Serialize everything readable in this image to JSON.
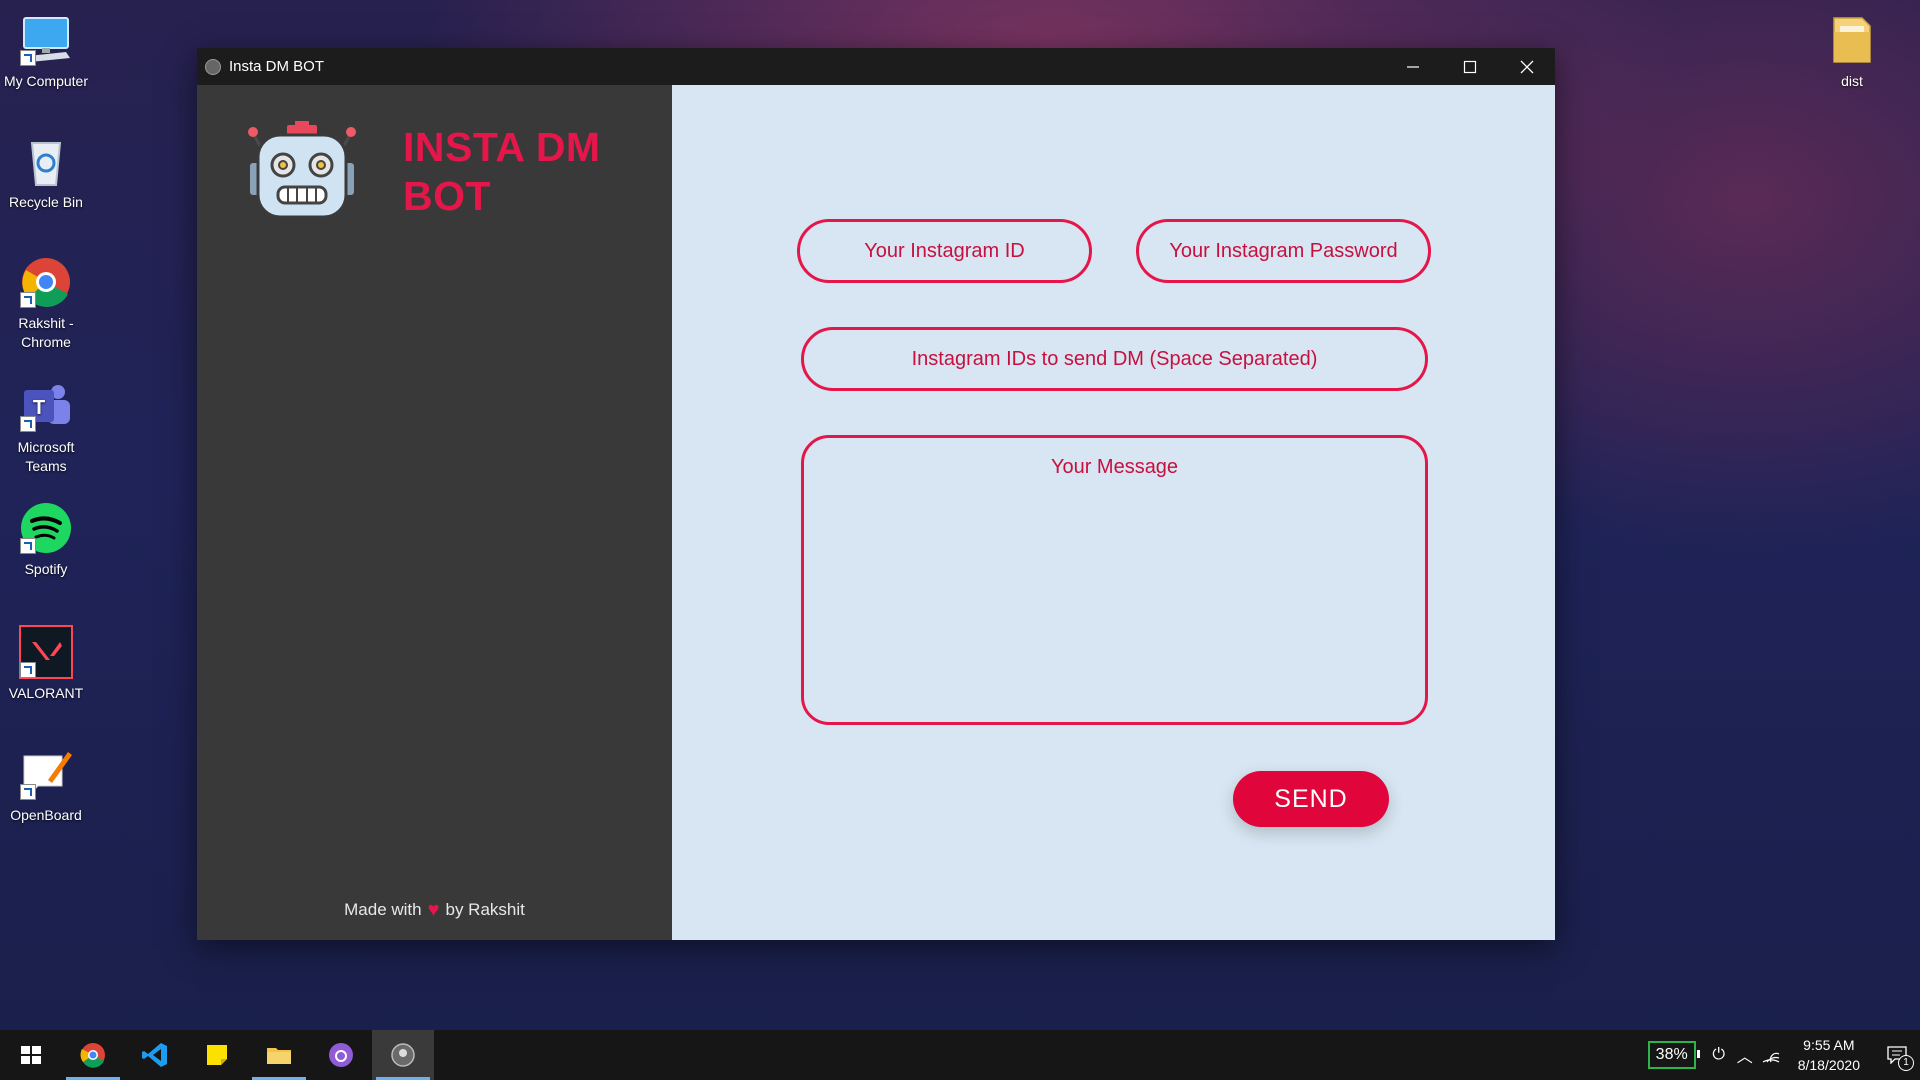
{
  "desktop": {
    "icons": [
      {
        "label": "My Computer",
        "icon": "computer-icon"
      },
      {
        "label": "Recycle Bin",
        "icon": "recycle-bin-icon"
      },
      {
        "label": "Rakshit - Chrome",
        "icon": "chrome-icon"
      },
      {
        "label": "Microsoft Teams",
        "icon": "teams-icon"
      },
      {
        "label": "Spotify",
        "icon": "spotify-icon"
      },
      {
        "label": "VALORANT",
        "icon": "valorant-icon"
      },
      {
        "label": "OpenBoard",
        "icon": "openboard-icon"
      },
      {
        "label": "dist",
        "icon": "folder-icon"
      }
    ]
  },
  "window": {
    "title": "Insta DM BOT"
  },
  "sidebar": {
    "brand_line1": "INSTA DM",
    "brand_line2": "BOT",
    "footer_prefix": "Made with",
    "footer_suffix": "by Rakshit"
  },
  "form": {
    "id_placeholder": "Your Instagram ID",
    "password_placeholder": "Your Instagram Password",
    "targets_placeholder": "Instagram IDs to send DM (Space Separated)",
    "message_placeholder": "Your Message",
    "send_label": "SEND"
  },
  "taskbar": {
    "battery": "38%",
    "time": "9:55 AM",
    "date": "8/18/2020",
    "notifications": "1"
  },
  "colors": {
    "accent": "#e4164a",
    "main_bg": "#d7e6f2",
    "sidebar_bg": "#393939"
  }
}
